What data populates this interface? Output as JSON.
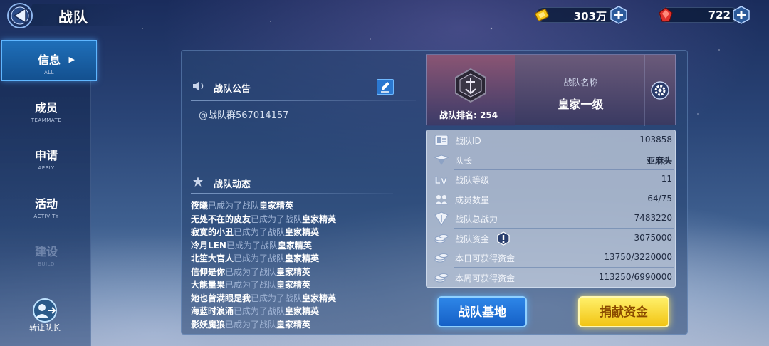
{
  "header": {
    "title": "战队",
    "back_icon": "back-arrow-icon",
    "gold": {
      "icon": "gold-coin-icon",
      "value": "303万",
      "color": "#f5c518"
    },
    "gems": {
      "icon": "red-gem-icon",
      "value": "722",
      "color": "#e0312c"
    }
  },
  "sidebar": {
    "items": [
      {
        "zh": "信息",
        "en": "ALL",
        "active": true
      },
      {
        "zh": "成员",
        "en": "TEAMMATE"
      },
      {
        "zh": "申请",
        "en": "APPLY"
      },
      {
        "zh": "活动",
        "en": "ACTIVITY"
      },
      {
        "zh": "建设",
        "en": "BUILD",
        "disabled": true
      }
    ],
    "transfer_label": "转让队长"
  },
  "announcement": {
    "title": "战队公告",
    "text": "@战队群567014157"
  },
  "dynamics": {
    "title": "战队动态",
    "rows": [
      {
        "name": "筱曦",
        "mid": "已成为了战队",
        "rank": "皇家精英"
      },
      {
        "name": "无处不在的皮友",
        "mid": "已成为了战队",
        "rank": "皇家精英"
      },
      {
        "name": "寂寞的小丑",
        "mid": "已成为了战队",
        "rank": "皇家精英"
      },
      {
        "name": "冷月LEN",
        "mid": "已成为了战队",
        "rank": "皇家精英"
      },
      {
        "name": "北笙大官人",
        "mid": "已成为了战队",
        "rank": "皇家精英"
      },
      {
        "name": "信仰是你",
        "mid": "已成为了战队",
        "rank": "皇家精英"
      },
      {
        "name": "大能量果",
        "mid": "已成为了战队",
        "rank": "皇家精英"
      },
      {
        "name": "她也曾满眼是我",
        "mid": "已成为了战队",
        "rank": "皇家精英"
      },
      {
        "name": "海蓝时浪涌",
        "mid": "已成为了战队",
        "rank": "皇家精英"
      },
      {
        "name": "影妖魔狼",
        "mid": "已成为了战队",
        "rank": "皇家精英"
      }
    ]
  },
  "team": {
    "rank_label": "战队排名:",
    "rank_value": "254",
    "name_label": "战队名称",
    "name_value": "皇家一级"
  },
  "info": [
    {
      "icon": "id-card-icon",
      "label": "战队ID",
      "value": "103858"
    },
    {
      "icon": "captain-badge-icon",
      "label": "队长",
      "value": "亚麻头",
      "bold": true
    },
    {
      "icon": "level-icon",
      "label": "战队等级",
      "value": "11"
    },
    {
      "icon": "members-icon",
      "label": "成员数量",
      "value": "64/75"
    },
    {
      "icon": "power-icon",
      "label": "战队总战力",
      "value": "7483220"
    },
    {
      "icon": "coins-icon",
      "label": "战队资金",
      "value": "3075000",
      "warn": true
    },
    {
      "icon": "coins-icon",
      "label": "本日可获得资金",
      "value": "13750/3220000"
    },
    {
      "icon": "coins-icon",
      "label": "本周可获得资金",
      "value": "113250/6990000"
    }
  ],
  "buttons": {
    "base": "战队基地",
    "donate": "捐献资金"
  }
}
